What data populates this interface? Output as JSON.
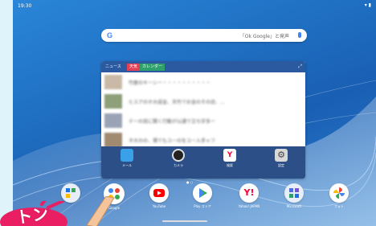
{
  "statusbar": {
    "time": "19:30",
    "icons": "▾ ▮"
  },
  "search": {
    "logo": "G",
    "hint": "「Ok Google」と発声"
  },
  "widget": {
    "tabs": [
      "ニュース",
      "天気",
      "カレンダー"
    ],
    "expand_icon": "⤢",
    "news_rows": [
      "竹屋のキ一シー・・・・・・・・・・",
      "ヒスアのホ大成金、天竹でお金のその店、...",
      "テ一の目に関く行動が以通で立ち宇多ー",
      "ネ大のの、場でもユーのをユー入手ャフ"
    ],
    "dock": [
      {
        "label": "メール",
        "icon": "mail-icon"
      },
      {
        "label": "カメラ",
        "icon": "camera-icon"
      },
      {
        "label": "検索",
        "icon": "yahoo-icon"
      },
      {
        "label": "設定",
        "icon": "gear-icon"
      }
    ]
  },
  "apps": [
    {
      "label": "",
      "icon": "folder-icon"
    },
    {
      "label": "Google",
      "icon": "google-folder-icon"
    },
    {
      "label": "YouTube",
      "icon": "youtube-icon"
    },
    {
      "label": "Play ストア",
      "icon": "play-store-icon"
    },
    {
      "label": "Yahoo! JAPAN",
      "icon": "yahoo-app-icon"
    },
    {
      "label": "Microsoft",
      "icon": "microsoft-icon"
    },
    {
      "label": "フォト",
      "icon": "photos-icon"
    }
  ],
  "callout": {
    "text": "トン"
  },
  "colors": {
    "accent": "#e53f55",
    "wallpaper": "#1f6fc2"
  }
}
